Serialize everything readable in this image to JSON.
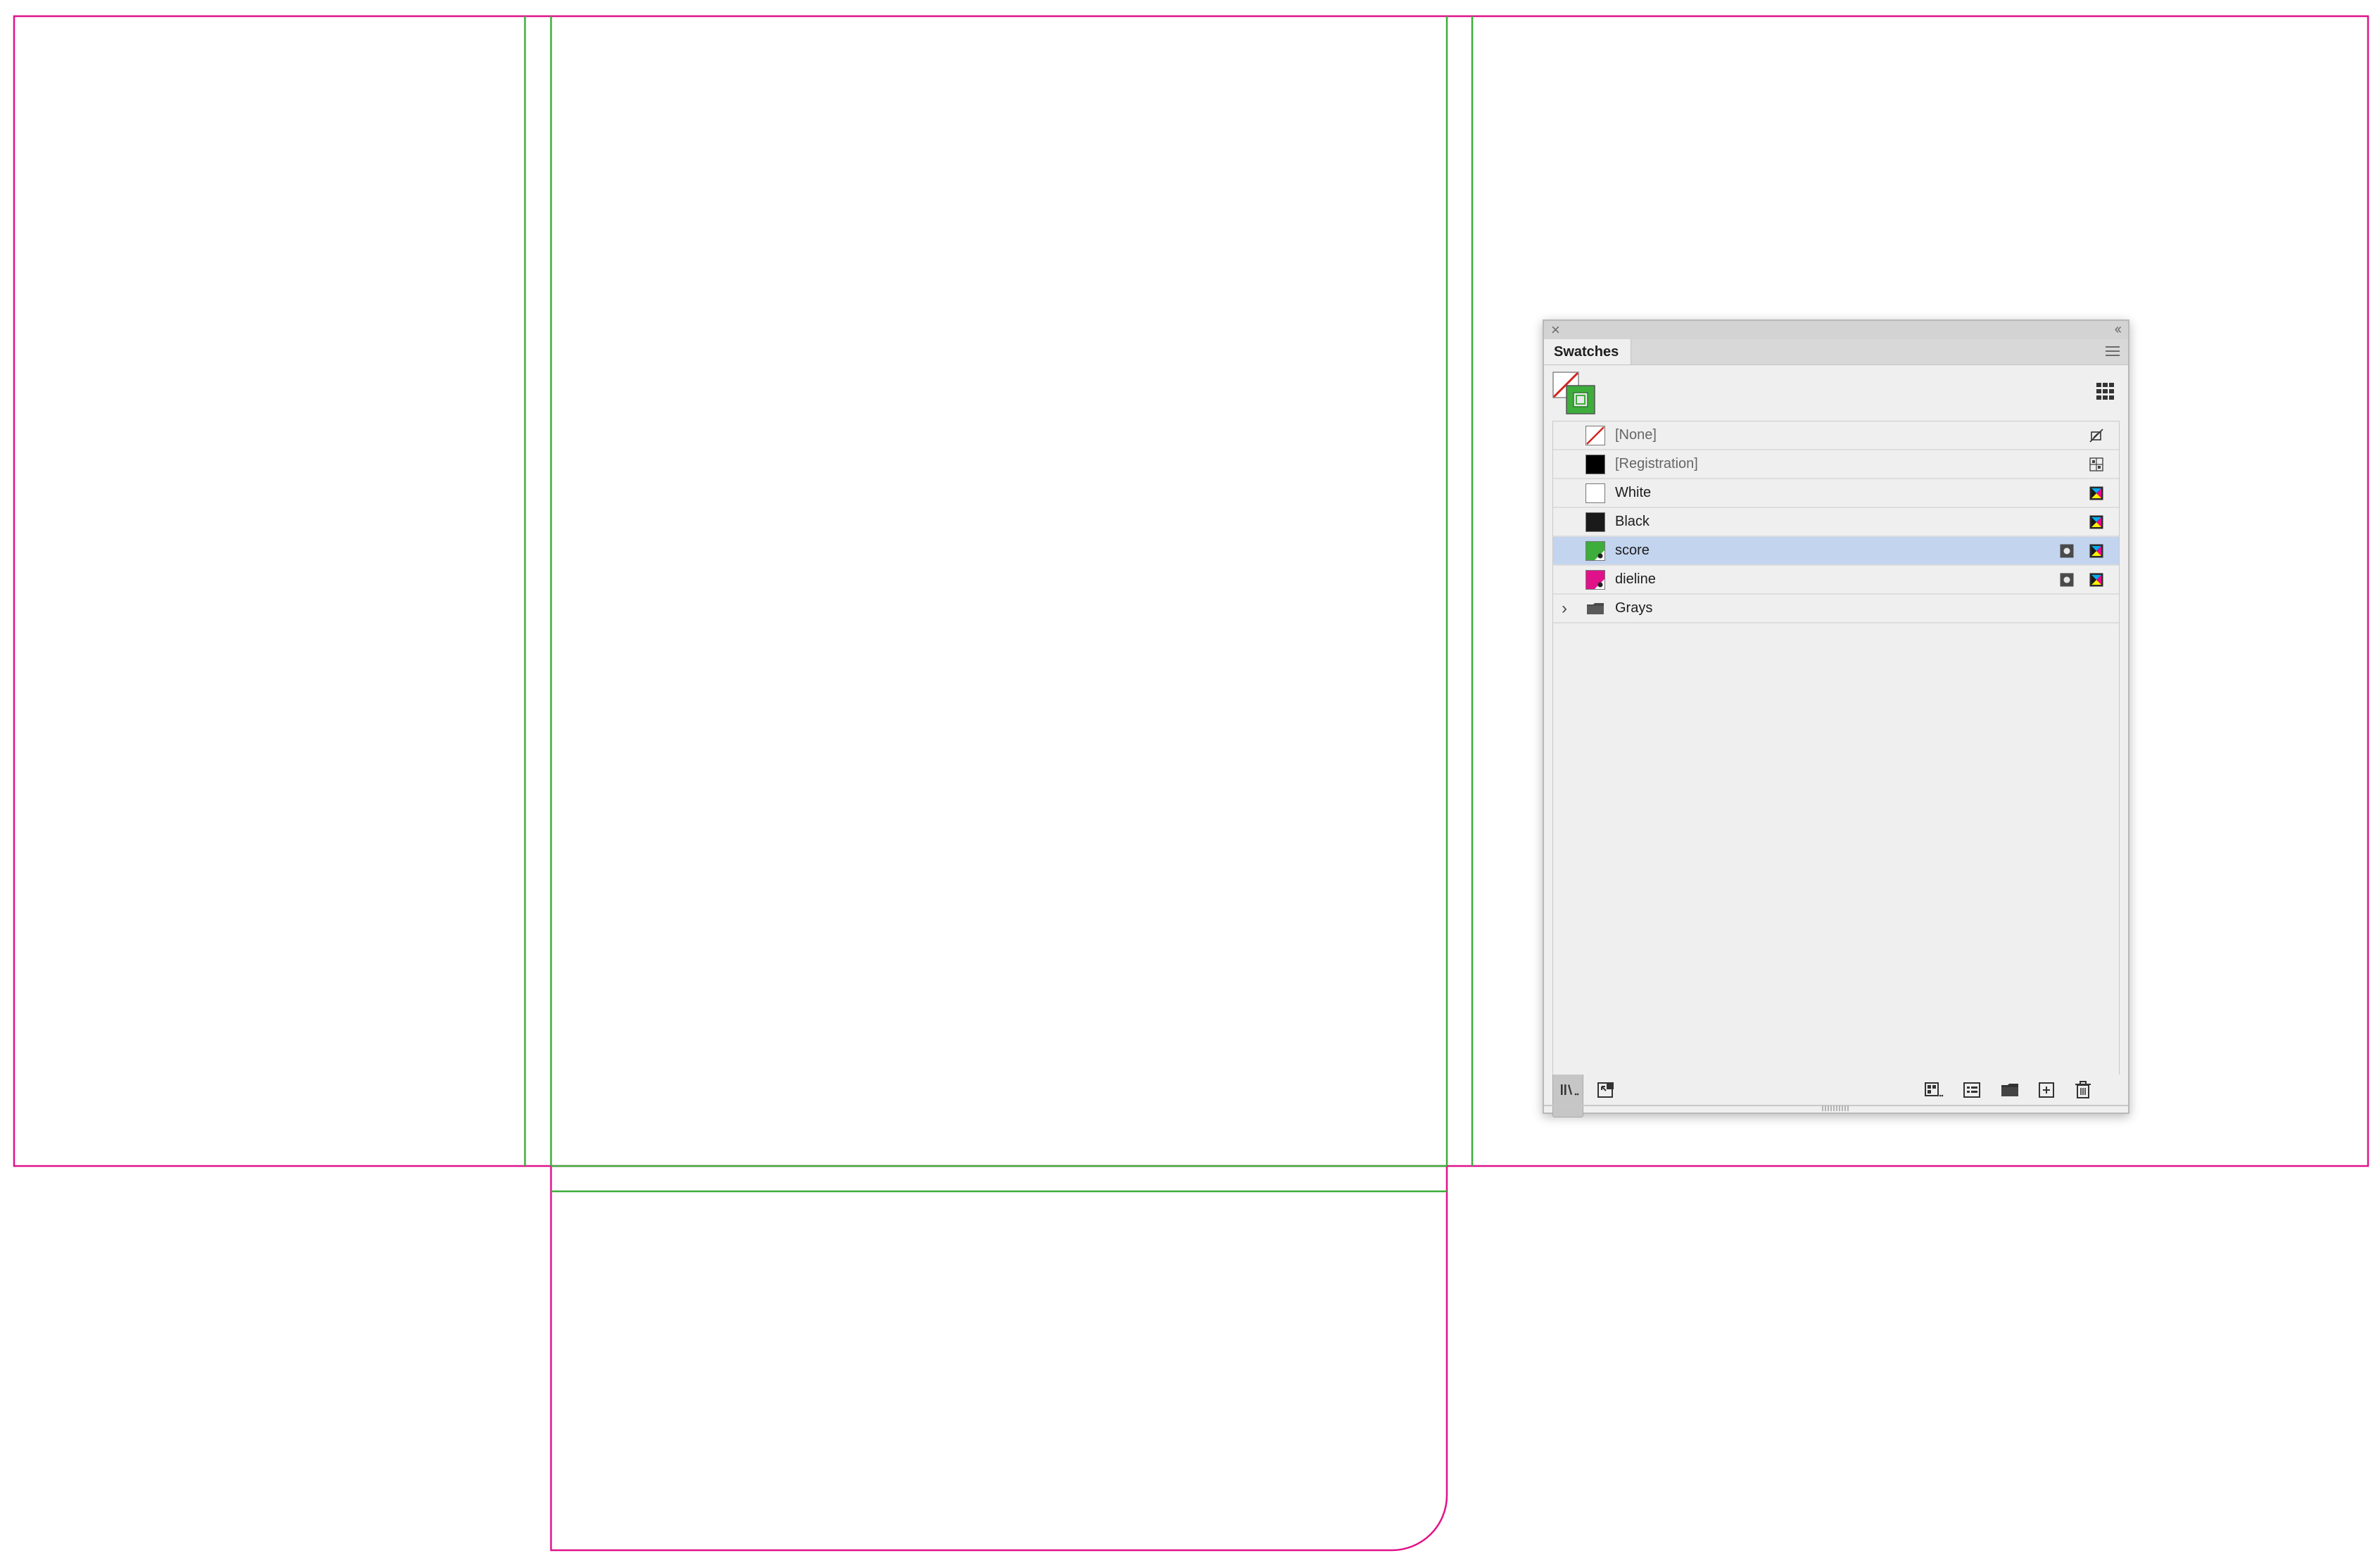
{
  "panel": {
    "tab_label": "Swatches",
    "swatches": [
      {
        "name": "[None]",
        "kind": "none",
        "dim": true,
        "ind2": "",
        "ind1": "no-edit-icon"
      },
      {
        "name": "[Registration]",
        "kind": "registration",
        "dim": true,
        "ind2": "",
        "ind1": "registration-icon"
      },
      {
        "name": "White",
        "kind": "color",
        "color": "#ffffff",
        "dim": false,
        "ind2": "",
        "ind1": "cmyk-icon"
      },
      {
        "name": "Black",
        "kind": "color",
        "color": "#1a1a1a",
        "dim": false,
        "ind2": "",
        "ind1": "cmyk-icon"
      },
      {
        "name": "score",
        "kind": "spot",
        "color": "#3dad3b",
        "dim": false,
        "selected": true,
        "ind2": "spot-icon",
        "ind1": "cmyk-icon"
      },
      {
        "name": "dieline",
        "kind": "spot",
        "color": "#e0128a",
        "dim": false,
        "ind2": "spot-icon",
        "ind1": "cmyk-icon"
      },
      {
        "name": "Grays",
        "kind": "group",
        "dim": false,
        "ind2": "",
        "ind1": ""
      }
    ]
  },
  "colors": {
    "dieline": "#e0128a",
    "score": "#3dad3b",
    "selection": "#c3d4ef"
  }
}
